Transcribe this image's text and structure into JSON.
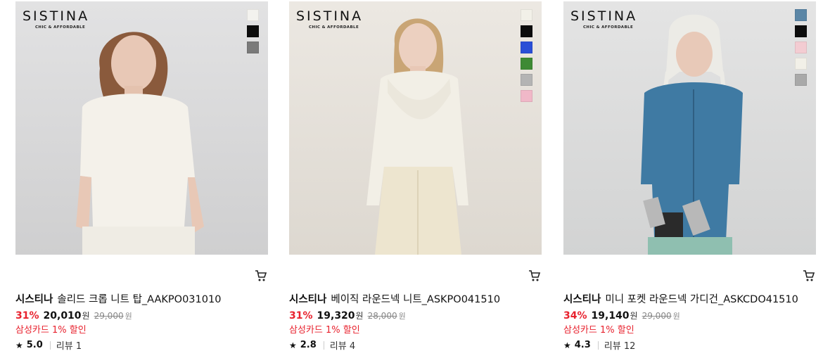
{
  "brand_sub": "CHIC & AFFORDABLE",
  "products": [
    {
      "brand_logo": "SISTINA",
      "bg": "#d9d9da",
      "swatches": [
        "#f3f2ee",
        "#0c0c0c",
        "#7a7a7a"
      ],
      "brand": "시스티나",
      "name": "솔리드 크롭 니트 탑_AAKPO031010",
      "rate": "31%",
      "price": "20,010",
      "won": "원",
      "original": "29,000",
      "promo": "삼성카드 1% 할인",
      "score": "5.0",
      "review": "리뷰 1"
    },
    {
      "brand_logo": "SISTINA",
      "bg": "#e6e2dc",
      "swatches": [
        "#f2f0e8",
        "#0c0c0c",
        "#2a4fd6",
        "#3e8a34",
        "#b4b4b4",
        "#f0b8c8"
      ],
      "brand": "시스티나",
      "name": "베이직 라운드넥 니트_ASKPO041510",
      "rate": "31%",
      "price": "19,320",
      "won": "원",
      "original": "28,000",
      "promo": "삼성카드 1% 할인",
      "score": "2.8",
      "review": "리뷰 4"
    },
    {
      "brand_logo": "SISTINA",
      "bg": "#dcdcdc",
      "swatches": [
        "#5b86a6",
        "#0c0c0c",
        "#f3ccd2",
        "#f2f0e8",
        "#a9a9a9"
      ],
      "brand": "시스티나",
      "name": "미니 포켓 라운드넥 가디건_ASKCDO41510",
      "rate": "34%",
      "price": "19,140",
      "won": "원",
      "original": "29,000",
      "promo": "삼성카드 1% 할인",
      "score": "4.3",
      "review": "리뷰 12"
    }
  ]
}
